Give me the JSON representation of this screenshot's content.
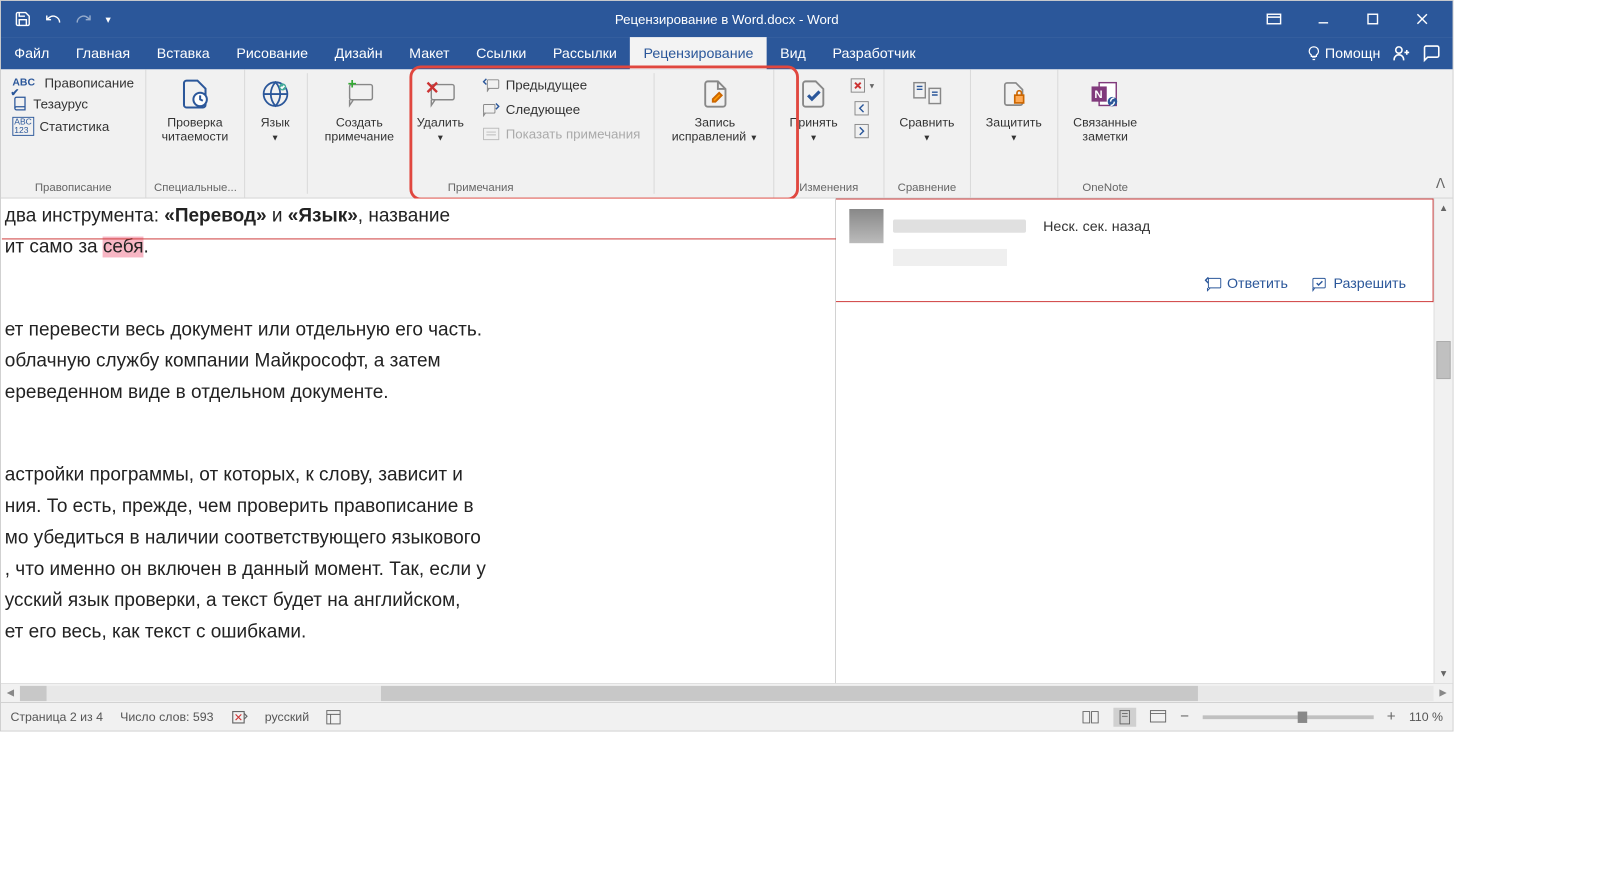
{
  "title": "Рецензирование в Word.docx  -  Word",
  "menu": {
    "file": "Файл",
    "home": "Главная",
    "insert": "Вставка",
    "draw": "Рисование",
    "design": "Дизайн",
    "layout": "Макет",
    "references": "Ссылки",
    "mailings": "Рассылки",
    "review": "Рецензирование",
    "view": "Вид",
    "developer": "Разработчик",
    "help": "Помощн"
  },
  "ribbon": {
    "proofing": {
      "spelling": "Правописание",
      "thesaurus": "Тезаурус",
      "statistics": "Статистика",
      "label": "Правописание"
    },
    "accessibility": {
      "readability": "Проверка\nчитаемости",
      "label": "Специальные..."
    },
    "language": {
      "btn": "Язык",
      "label": ""
    },
    "comments": {
      "new": "Создать\nпримечание",
      "delete": "Удалить",
      "previous": "Предыдущее",
      "next": "Следующее",
      "show": "Показать примечания",
      "label": "Примечания"
    },
    "tracking": {
      "track": "Запись\nисправлений"
    },
    "changes": {
      "accept": "Принять",
      "label": "Изменения"
    },
    "compare": {
      "btn": "Сравнить",
      "label": "Сравнение"
    },
    "protect": {
      "btn": "Защитить"
    },
    "onenote": {
      "btn": "Связанные\nзаметки",
      "label": "OneNote"
    }
  },
  "document": {
    "line1a": "два инструмента: ",
    "line1b": "«Перевод»",
    "line1c": " и ",
    "line1d": "«Язык»",
    "line1e": ", название",
    "line2a": "ит само за ",
    "line2b": "себя",
    "line2c": ".",
    "line3": "ет перевести весь документ или отдельную его часть.",
    "line4": " облачную службу компании Майкрософт, а затем",
    "line5": "ереведенном виде в отдельном документе.",
    "line6": "астройки программы, от которых, к слову, зависит и",
    "line7": "ния. То есть, прежде, чем проверить правописание в",
    "line8": "мо убедиться в наличии соответствующего языкового",
    "line9": ", что именно он включен в данный момент. Так, если у",
    "line10": "усский язык проверки, а текст будет на английском,",
    "line11": "ет его весь, как текст с ошибками."
  },
  "comment": {
    "time": "Неск. сек. назад",
    "reply": "Ответить",
    "resolve": "Разрешить"
  },
  "status": {
    "page": "Страница 2 из 4",
    "words": "Число слов: 593",
    "lang": "русский",
    "zoom": "110 %"
  }
}
